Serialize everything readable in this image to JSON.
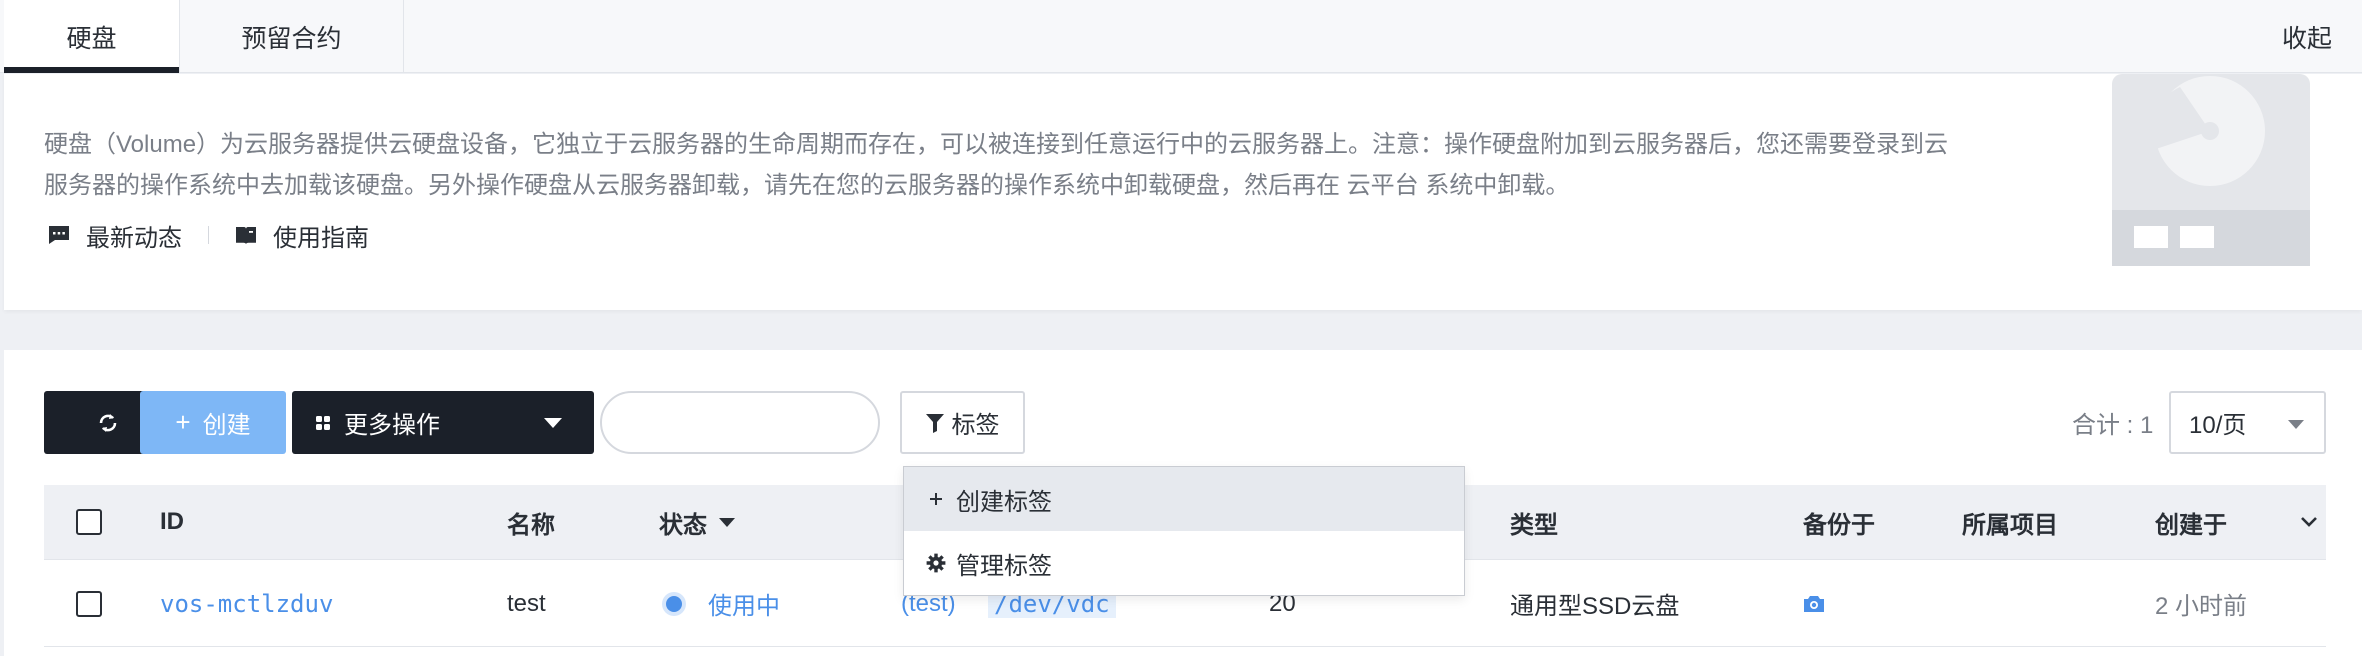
{
  "tabs": [
    {
      "label": "硬盘",
      "active": true
    },
    {
      "label": "预留合约",
      "active": false
    }
  ],
  "collapse_label": "收起",
  "intro": {
    "description": "硬盘（Volume）为云服务器提供云硬盘设备，它独立于云服务器的生命周期而存在，可以被连接到任意运行中的云服务器上。注意：操作硬盘附加到云服务器后，您还需要登录到云服务器的操作系统中去加载该硬盘。另外操作硬盘从云服务器卸载，请先在您的云服务器的操作系统中卸载硬盘，然后再在 云平台 系统中卸载。",
    "links": [
      {
        "label": "最新动态",
        "icon": "message-icon"
      },
      {
        "label": "使用指南",
        "icon": "book-icon"
      }
    ]
  },
  "toolbar": {
    "create_label": "创建",
    "more_label": "更多操作",
    "search_value": "",
    "tag_filter_label": "标签",
    "total_label": "合计 : 1",
    "page_size": "10/页"
  },
  "tag_menu": {
    "items": [
      {
        "label": "创建标签",
        "icon": "plus-icon"
      },
      {
        "label": "管理标签",
        "icon": "gear-icon"
      }
    ]
  },
  "table": {
    "columns": [
      "ID",
      "名称",
      "状态",
      "类型",
      "备份于",
      "所属项目",
      "创建于"
    ],
    "rows": [
      {
        "id": "vos-mctlzduv",
        "name": "test",
        "status": "使用中",
        "attached_to": "(test)",
        "device": "/dev/vdc",
        "size": "20",
        "type": "通用型SSD云盘",
        "backup_icon": "camera-icon",
        "project": "",
        "created": "2 小时前"
      }
    ]
  },
  "colors": {
    "primary_dark": "#1b2029",
    "accent_blue": "#4a8fe8",
    "create_button": "#7eb7f6",
    "page_background": "#eef0f4"
  }
}
